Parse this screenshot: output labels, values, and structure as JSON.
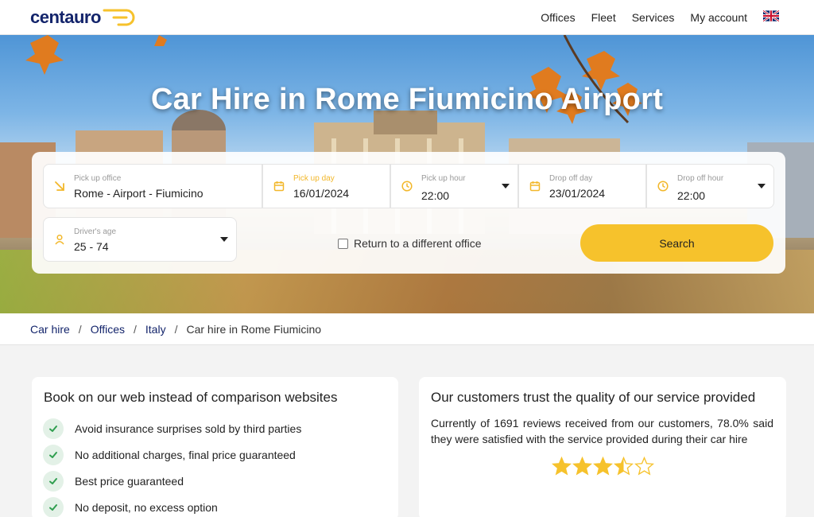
{
  "header": {
    "logo_text": "centauro",
    "nav": [
      "Offices",
      "Fleet",
      "Services",
      "My account"
    ],
    "language_flag": "uk-flag-icon"
  },
  "hero": {
    "title": "Car Hire in Rome Fiumicino Airport"
  },
  "booking": {
    "pickup_office": {
      "label": "Pick up office",
      "value": "Rome - Airport - Fiumicino",
      "icon": "arrow-down-right-icon"
    },
    "pickup_day": {
      "label": "Pick up day",
      "value": "16/01/2024",
      "icon": "calendar-icon"
    },
    "pickup_hour": {
      "label": "Pick up hour",
      "value": "22:00",
      "icon": "clock-icon"
    },
    "dropoff_day": {
      "label": "Drop off day",
      "value": "23/01/2024",
      "icon": "calendar-icon"
    },
    "dropoff_hour": {
      "label": "Drop off hour",
      "value": "22:00",
      "icon": "clock-icon"
    },
    "drivers_age": {
      "label": "Driver's age",
      "value": "25 - 74",
      "icon": "person-icon"
    },
    "return_different": {
      "label": "Return to a different office",
      "checked": false
    },
    "search_label": "Search"
  },
  "breadcrumb": {
    "items": [
      "Car hire",
      "Offices",
      "Italy"
    ],
    "current": "Car hire in Rome Fiumicino",
    "separator": "/"
  },
  "benefits": {
    "title": "Book on our web instead of comparison websites",
    "items": [
      "Avoid insurance surprises sold by third parties",
      "No additional charges, final price guaranteed",
      "Best price guaranteed",
      "No deposit, no excess option"
    ]
  },
  "reviews": {
    "title": "Our customers trust the quality of our service provided",
    "text": "Currently of 1691 reviews received from our customers, 78.0% said they were satisfied with the service provided during their car hire",
    "rating": 3.5,
    "max_rating": 5
  },
  "colors": {
    "brand_navy": "#13246b",
    "accent_yellow": "#f6c22c",
    "tick_green": "#2f9e4f",
    "star": "#f6c22c"
  }
}
